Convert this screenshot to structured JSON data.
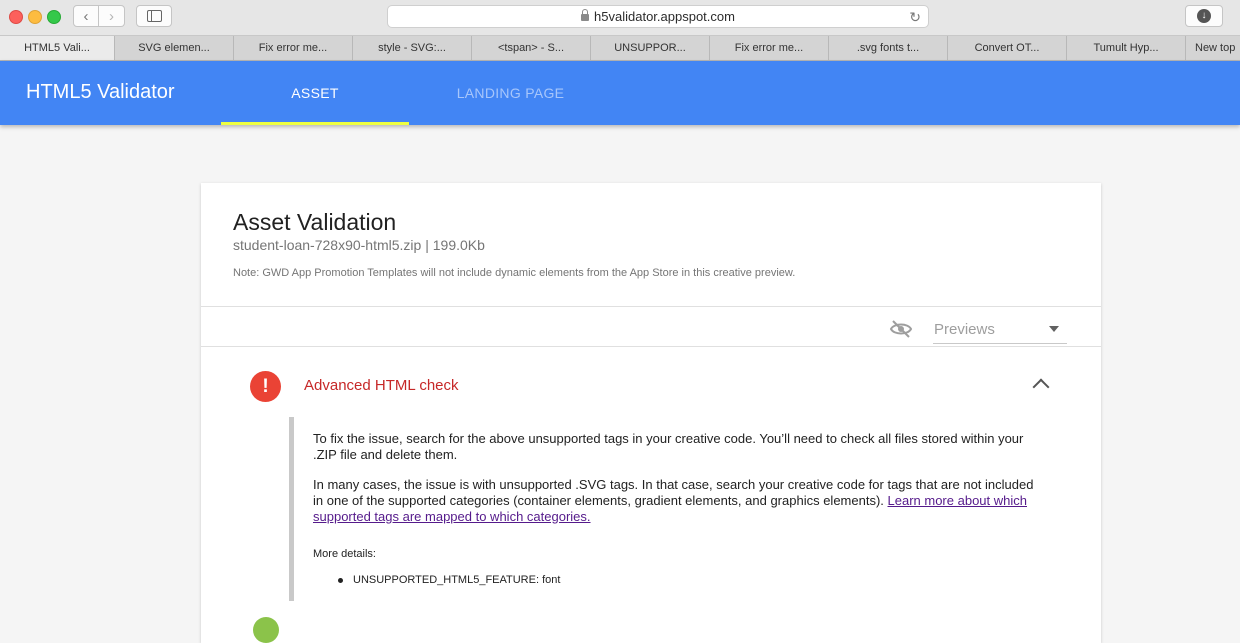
{
  "browser": {
    "url": "h5validator.appspot.com",
    "tabs": [
      {
        "label": "HTML5 Vali...",
        "active": true
      },
      {
        "label": "SVG elemen...",
        "active": false
      },
      {
        "label": "Fix error me...",
        "active": false
      },
      {
        "label": "style - SVG:...",
        "active": false
      },
      {
        "label": "<tspan> - S...",
        "active": false
      },
      {
        "label": "UNSUPPOR...",
        "active": false
      },
      {
        "label": "Fix error me...",
        "active": false
      },
      {
        "label": ".svg fonts t...",
        "active": false
      },
      {
        "label": "Convert OT...",
        "active": false
      },
      {
        "label": "Tumult Hyp...",
        "active": false
      },
      {
        "label": "New top",
        "active": false
      }
    ]
  },
  "app": {
    "title": "HTML5 Validator",
    "tabs": {
      "asset": "ASSET",
      "landing": "LANDING PAGE"
    },
    "brand_color": "#4285f4",
    "indicator_color": "#eeff41"
  },
  "card": {
    "title": "Asset Validation",
    "subtitle": "student-loan-728x90-html5.zip | 199.0Kb",
    "note": "Note: GWD App Promotion Templates will not include dynamic elements from the App Store in this creative preview.",
    "previews_label": "Previews",
    "visibility_icon": "visibility-off-icon"
  },
  "check": {
    "icon": "error-icon",
    "status_color": "#ea4335",
    "title": "Advanced HTML check",
    "para1": "To fix the issue, search for the above unsupported tags in your creative code. You’ll need to check all files stored within your .ZIP file and delete them.",
    "para2": "In many cases, the issue is with unsupported .SVG tags. In that case, search your creative code for tags that are not included in one of the supported categories (container elements, gradient elements, and graphics elements).",
    "link": "Learn more about which supported tags are mapped to which categories.",
    "more_details_label": "More details:",
    "details": [
      "UNSUPPORTED_HTML5_FEATURE: font"
    ]
  }
}
